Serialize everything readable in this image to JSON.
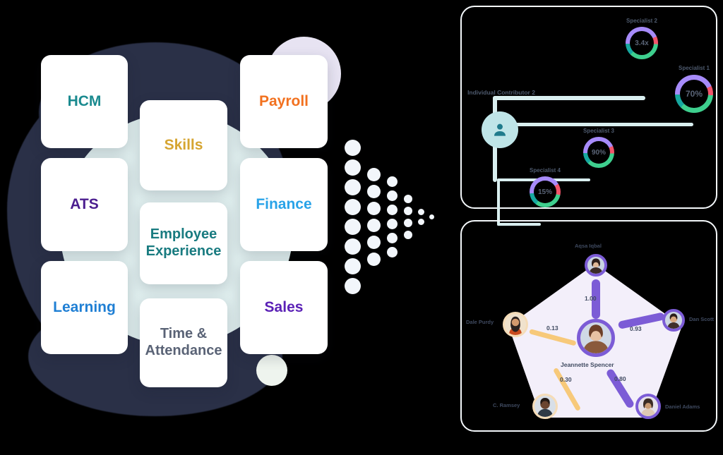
{
  "product_cards": [
    {
      "id": "hcm",
      "label": "HCM",
      "color": "#1a8a8f"
    },
    {
      "id": "ats",
      "label": "ATS",
      "color": "#4b1d8f"
    },
    {
      "id": "learning",
      "label": "Learning",
      "color": "#1f7fd4"
    },
    {
      "id": "skills",
      "label": "Skills",
      "color": "#d6a531"
    },
    {
      "id": "employee-experience",
      "label": "Employee Experience",
      "color": "#197b80"
    },
    {
      "id": "time-attendance",
      "label": "Time & Attendance",
      "color": "#5a6376"
    },
    {
      "id": "payroll",
      "label": "Payroll",
      "color": "#f2711f"
    },
    {
      "id": "finance",
      "label": "Finance",
      "color": "#29a3e8"
    },
    {
      "id": "sales",
      "label": "Sales",
      "color": "#5b21b6"
    }
  ],
  "flow_arrow": {
    "icon": "converging-dots-arrow",
    "columns": [
      8,
      6,
      6,
      4,
      2,
      1
    ]
  },
  "org_panel": {
    "root": {
      "label": "Individual Contributor 2",
      "icon": "person-avatar-icon"
    },
    "nodes": [
      {
        "id": "specialist-2",
        "label": "Specialist 2",
        "value": "3.4x"
      },
      {
        "id": "specialist-1",
        "label": "Specialist 1",
        "value": "70%"
      },
      {
        "id": "specialist-3",
        "label": "Specialist 3",
        "value": "90%"
      },
      {
        "id": "specialist-4",
        "label": "Specialist 4",
        "value": "15%"
      }
    ],
    "ring_colors": [
      "#3ecf8e",
      "#17a8a0",
      "#a78bfa",
      "#f2556b"
    ]
  },
  "network_panel": {
    "center": {
      "id": "jeannette-spencer",
      "label": "Jeannette Spencer"
    },
    "nodes": [
      {
        "id": "node-top",
        "label": "Aqsa Iqbal"
      },
      {
        "id": "node-right",
        "label": "Dan Scott"
      },
      {
        "id": "node-left",
        "label": "Dale Purdy"
      },
      {
        "id": "node-bottom-left",
        "label": "C. Ramsey"
      },
      {
        "id": "node-bottom-right",
        "label": "Daniel Adams"
      }
    ],
    "edges": [
      {
        "from": "jeannette-spencer",
        "to": "node-top",
        "weight": "1.00",
        "color": "#7c5cd6"
      },
      {
        "from": "jeannette-spencer",
        "to": "node-right",
        "weight": "0.93",
        "color": "#7c5cd6"
      },
      {
        "from": "jeannette-spencer",
        "to": "node-left",
        "weight": "0.13",
        "color": "#f7c97a"
      },
      {
        "from": "jeannette-spencer",
        "to": "node-bottom-left",
        "weight": "0.30",
        "color": "#f7c97a"
      },
      {
        "from": "jeannette-spencer",
        "to": "node-bottom-right",
        "weight": "0.80",
        "color": "#7c5cd6"
      }
    ],
    "polygon_fill": "#f3effa"
  }
}
